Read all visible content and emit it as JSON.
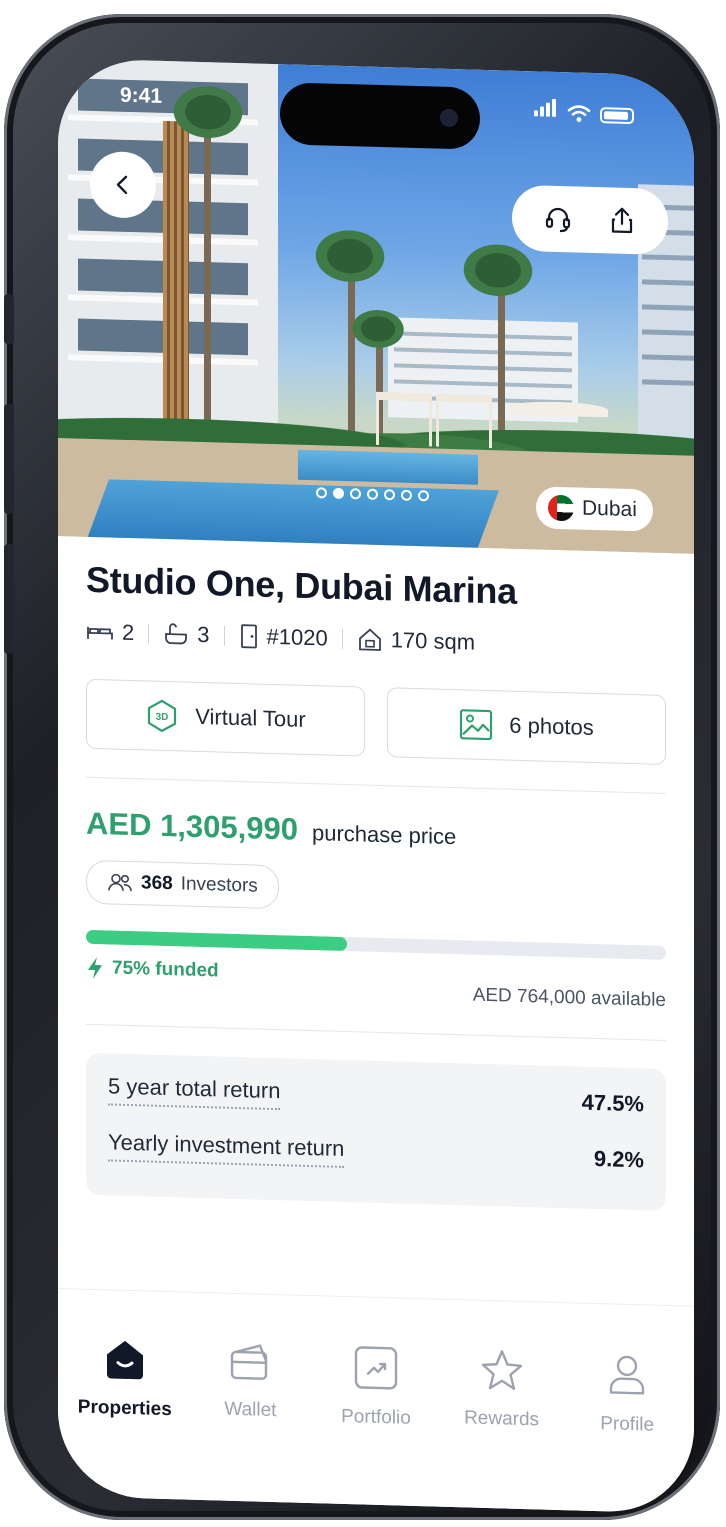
{
  "status_bar": {
    "time": "9:41"
  },
  "hero": {
    "location": "Dubai",
    "photo_count_dots": 7,
    "active_dot": 1
  },
  "property": {
    "title": "Studio One, Dubai Marina",
    "bedrooms": "2",
    "bathrooms": "3",
    "unit": "#1020",
    "area": "170 sqm"
  },
  "media_buttons": {
    "virtual_tour": "Virtual Tour",
    "virtual_tour_badge": "3D",
    "photos": "6 photos"
  },
  "funding": {
    "price": "AED 1,305,990",
    "price_label": "purchase price",
    "investors_count": "368",
    "investors_label": "Investors",
    "funded_fraction": 0.45,
    "funded_label": "75% funded",
    "available": "AED 764,000 available"
  },
  "returns": [
    {
      "label": "5 year total return",
      "value": "47.5%"
    },
    {
      "label": "Yearly investment return",
      "value": "9.2%"
    }
  ],
  "tabbar": {
    "items": [
      {
        "label": "Properties",
        "icon": "home-icon",
        "active": true
      },
      {
        "label": "Wallet",
        "icon": "wallet-icon",
        "active": false
      },
      {
        "label": "Portfolio",
        "icon": "portfolio-icon",
        "active": false
      },
      {
        "label": "Rewards",
        "icon": "star-icon",
        "active": false
      },
      {
        "label": "Profile",
        "icon": "user-icon",
        "active": false
      }
    ]
  },
  "colors": {
    "accent_green": "#2e9f6e",
    "progress_green": "#3ccd82",
    "phone_frame": "#1d2026"
  }
}
